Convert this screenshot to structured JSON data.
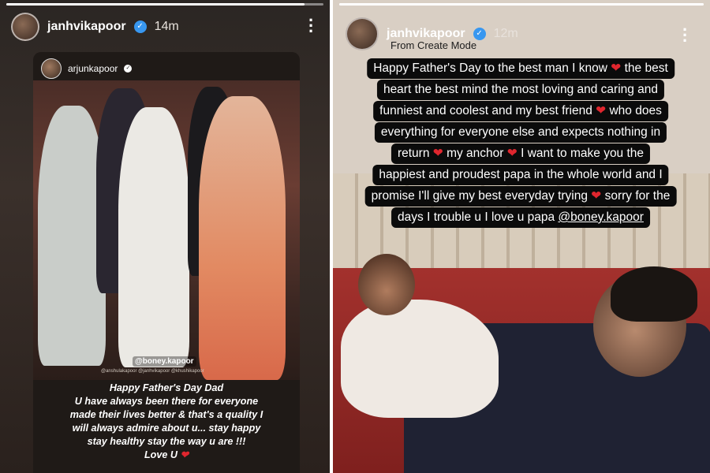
{
  "left_story": {
    "progress": 0.94,
    "username": "janhvikapoor",
    "time": "14m",
    "reshare": {
      "username": "arjunkapoor",
      "tag_main": "@boney.kapoor",
      "tag_small": "@anshulakapoor @janhvikapoor @khushikapoor",
      "caption_lines": [
        "Happy Father's Day Dad",
        "U have always been there for everyone",
        "made their lives better & that's a quality I",
        "will always admire about u... stay happy",
        "stay healthy stay the way u are !!!",
        "Love U"
      ]
    }
  },
  "right_story": {
    "progress": 1.0,
    "username": "janhvikapoor",
    "time": "12m",
    "subtitle": "From Create Mode",
    "text_lines": [
      "Happy Father's Day to the best man I know",
      "the best",
      "heart the best mind the most loving and caring and",
      "funniest and coolest and my best friend",
      "who does",
      "everything for everyone else and expects nothing in",
      "return",
      "my anchor",
      "I want to make you the",
      "happiest and proudest papa in the whole world and I",
      "promise I'll give my best everyday trying",
      "sorry for the",
      "days I trouble u I love u papa",
      "@boney.kapoor"
    ]
  },
  "icons": {
    "verified": "verified-badge-icon",
    "more": "more-options-icon",
    "heart": "red-heart-emoji"
  },
  "colors": {
    "verified_blue": "#3897f0",
    "heart_red": "#e0262e"
  }
}
